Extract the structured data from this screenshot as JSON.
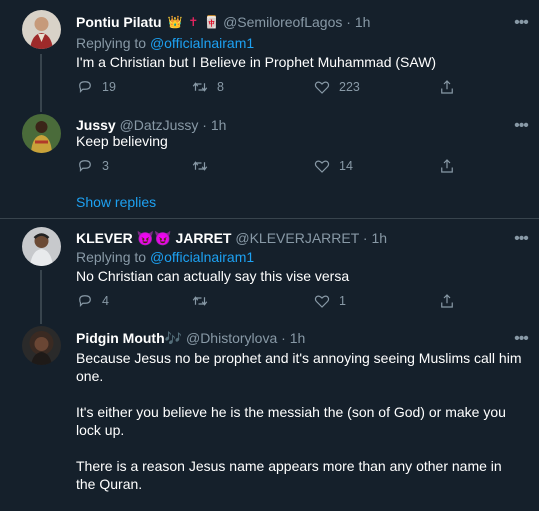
{
  "tweets": [
    {
      "name": "Pontiu Pilatu",
      "emojis": [
        "👑",
        "✝",
        "🀄"
      ],
      "handle": "@SemiloreofLagos",
      "dot": "·",
      "time": "1h",
      "replying_prefix": "Replying to",
      "replying_to": "@officialnairam1",
      "text": "I'm a Christian but I Believe in Prophet Muhammad (SAW)",
      "reply_count": "19",
      "retweet_count": "8",
      "like_count": "223"
    },
    {
      "name": "Jussy",
      "handle": "@DatzJussy",
      "dot": "·",
      "time": "1h",
      "text": "Keep believing",
      "reply_count": "3",
      "retweet_count": "",
      "like_count": "14"
    },
    {
      "name_part1": "KLEVER",
      "name_emojis": "😈😈",
      "name_part2": "JARRET",
      "handle": "@KLEVERJARRET",
      "dot": "·",
      "time": "1h",
      "replying_prefix": "Replying to",
      "replying_to": "@officialnairam1",
      "text": "No Christian can actually say this vise versa",
      "reply_count": "4",
      "retweet_count": "",
      "like_count": "1"
    },
    {
      "name": "Pidgin Mouth",
      "name_emoji": "🎶",
      "handle": "@Dhistorylova",
      "dot": "·",
      "time": "1h",
      "paragraphs": [
        "Because Jesus no be prophet and it's annoying seeing Muslims call him one.",
        "It's either you believe he is the messiah the (son of God) or make you lock up.",
        "There is a reason Jesus name appears more than any other name in the Quran."
      ]
    }
  ],
  "show_replies": "Show replies",
  "more_glyph": "•••",
  "colors": {
    "background": "#15202b",
    "secondary_text": "#8899a6",
    "link": "#1da1f2",
    "border": "#38444d"
  },
  "icons": [
    "reply-icon",
    "retweet-icon",
    "like-icon",
    "share-icon",
    "more-icon"
  ]
}
